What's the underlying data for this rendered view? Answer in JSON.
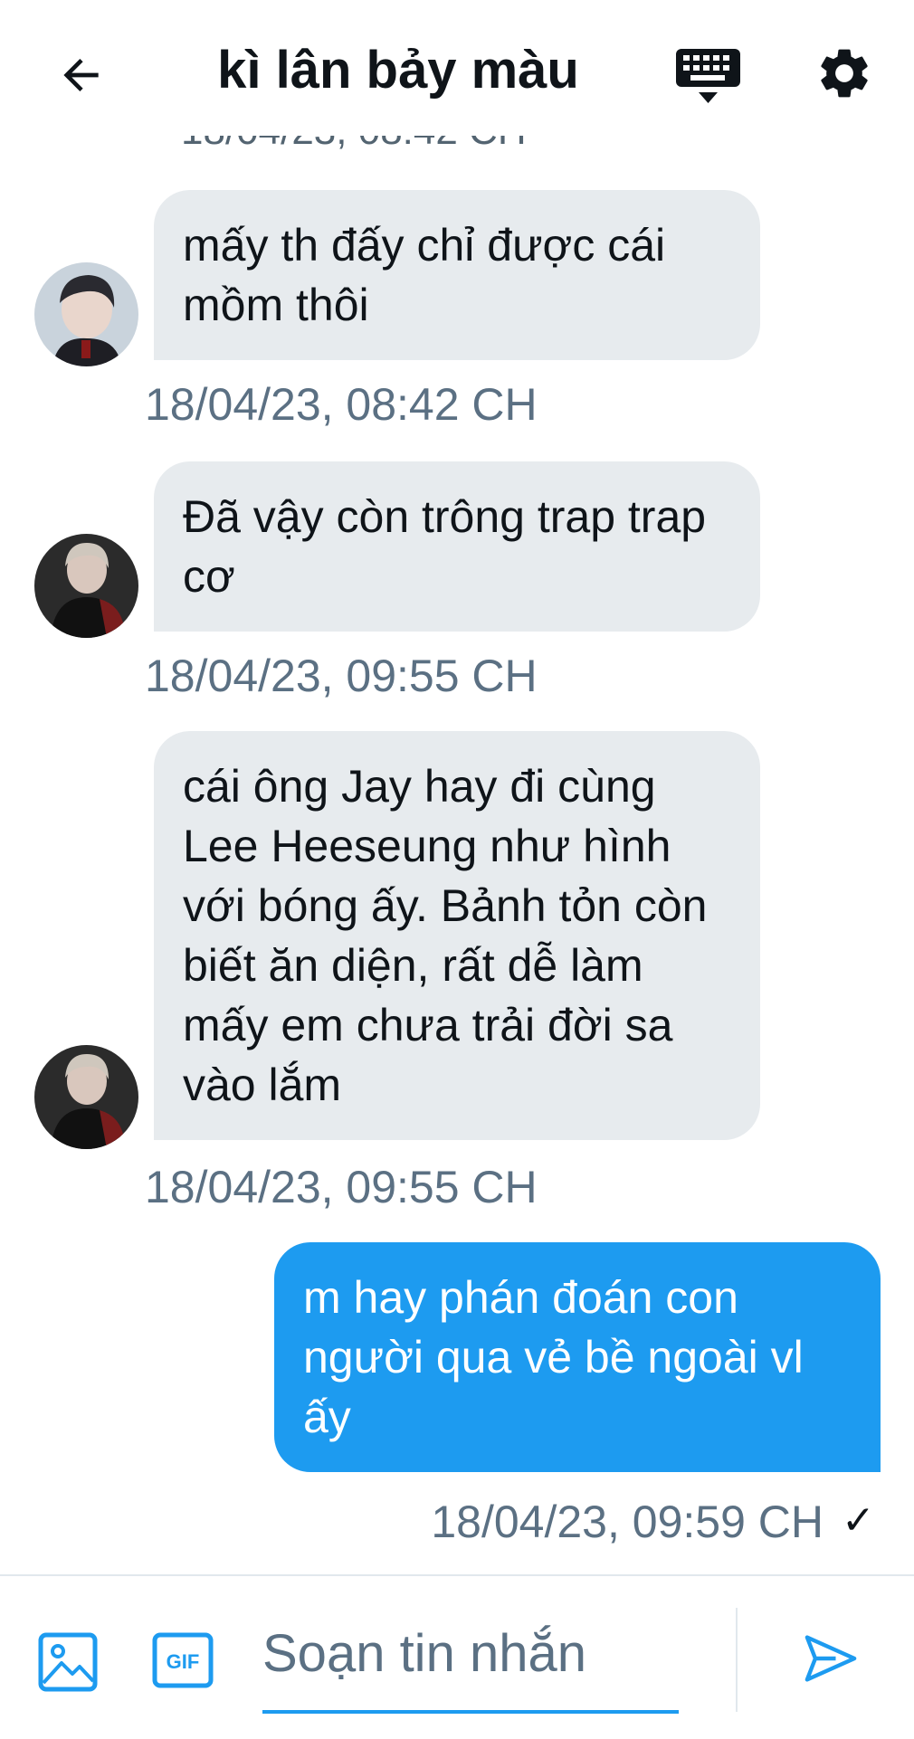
{
  "header": {
    "title": "kì lân bảy màu",
    "back_icon": "arrow-left-icon",
    "keyboard_icon": "keyboard-icon",
    "settings_icon": "gear-icon"
  },
  "cutoff_timestamp": "18/04/23, 08:42 CH",
  "messages": [
    {
      "direction": "incoming",
      "text": "mấy th đấy chỉ được cái mồm thôi",
      "time": "18/04/23, 08:42 CH"
    },
    {
      "direction": "incoming",
      "text": "Đã vậy còn trông trap trap cơ",
      "time": "18/04/23, 09:55 CH"
    },
    {
      "direction": "incoming",
      "text": "cái ông Jay hay đi cùng Lee Heeseung như hình với bóng ấy. Bảnh tỏn còn biết ăn diện, rất dễ làm mấy em chưa trải đời sa vào lắm",
      "time": "18/04/23, 09:55 CH"
    },
    {
      "direction": "outgoing",
      "text": "m hay phán đoán con người qua vẻ bề ngoài vl ấy",
      "time": "18/04/23, 09:59 CH",
      "status": "✓"
    }
  ],
  "composer": {
    "placeholder": "Soạn tin nhắn",
    "image_icon": "image-icon",
    "gif_icon": "gif-icon",
    "send_icon": "send-icon",
    "gif_label": "GIF"
  },
  "colors": {
    "accent": "#1d9bf0",
    "incoming_bubble": "#e7ebee",
    "timestamp": "#5b7083"
  }
}
